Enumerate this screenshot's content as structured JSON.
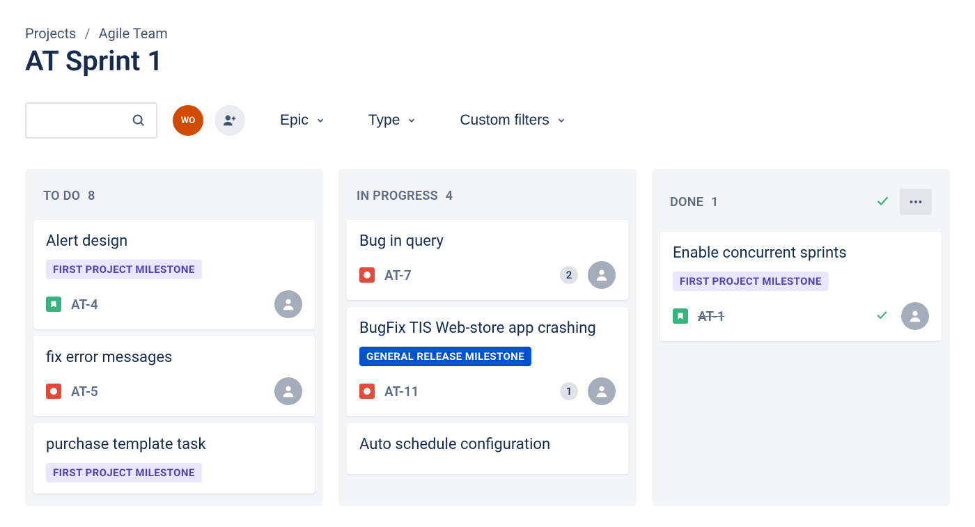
{
  "breadcrumb": {
    "root": "Projects",
    "project": "Agile Team"
  },
  "page_title": "AT Sprint 1",
  "toolbar": {
    "avatar_initials": "WO",
    "filters": {
      "epic": "Epic",
      "type": "Type",
      "custom": "Custom filters"
    }
  },
  "columns": [
    {
      "title": "To Do",
      "count": "8",
      "has_check": false,
      "has_more": false,
      "cards": [
        {
          "title": "Alert design",
          "epic": "First Project Milestone",
          "epic_style": "purple",
          "type": "story",
          "key": "AT-4",
          "strike": false,
          "badge": null,
          "done_check": false
        },
        {
          "title": "fix error messages",
          "epic": null,
          "epic_style": null,
          "type": "bug",
          "key": "AT-5",
          "strike": false,
          "badge": null,
          "done_check": false
        },
        {
          "title": "purchase template task",
          "epic": "First Project Milestone",
          "epic_style": "purple",
          "type": null,
          "key": null,
          "strike": false,
          "badge": null,
          "done_check": false,
          "truncated": true
        }
      ]
    },
    {
      "title": "In Progress",
      "count": "4",
      "has_check": false,
      "has_more": false,
      "cards": [
        {
          "title": "Bug in query",
          "epic": null,
          "epic_style": null,
          "type": "bug",
          "key": "AT-7",
          "strike": false,
          "badge": "2",
          "done_check": false
        },
        {
          "title": "BugFix TIS Web-store app crashing",
          "epic": "General Release Milestone",
          "epic_style": "blue",
          "type": "bug",
          "key": "AT-11",
          "strike": false,
          "badge": "1",
          "done_check": false
        },
        {
          "title": "Auto schedule configuration",
          "epic": null,
          "epic_style": null,
          "type": null,
          "key": null,
          "strike": false,
          "badge": null,
          "done_check": false,
          "truncated": true
        }
      ]
    },
    {
      "title": "Done",
      "count": "1",
      "has_check": true,
      "has_more": true,
      "cards": [
        {
          "title": "Enable concurrent sprints",
          "epic": "First Project Milestone",
          "epic_style": "purple",
          "type": "story",
          "key": "AT-1",
          "strike": true,
          "badge": null,
          "done_check": true
        }
      ]
    }
  ]
}
